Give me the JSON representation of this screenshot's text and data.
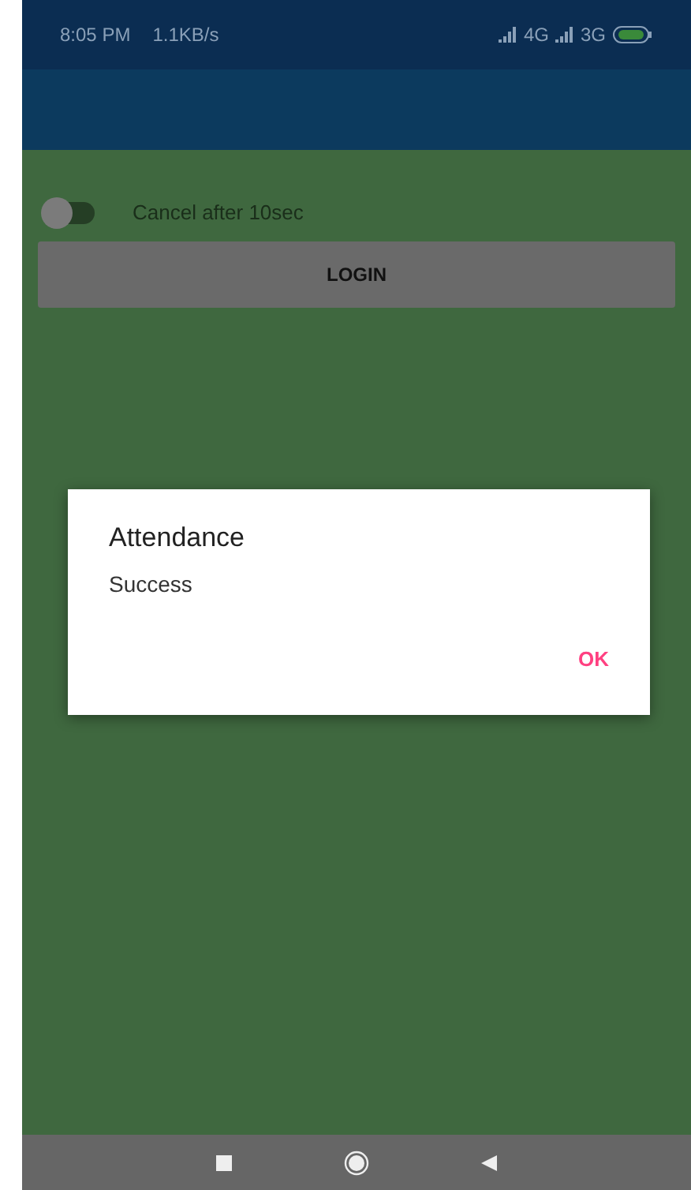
{
  "status_bar": {
    "time": "8:05 PM",
    "speed": "1.1KB/s",
    "network_1": "4G",
    "network_2": "3G"
  },
  "toggle": {
    "label": "Cancel after 10sec",
    "on": false
  },
  "login_button": {
    "label": "LOGIN"
  },
  "dialog": {
    "title": "Attendance",
    "message": "Success",
    "button": "OK"
  }
}
